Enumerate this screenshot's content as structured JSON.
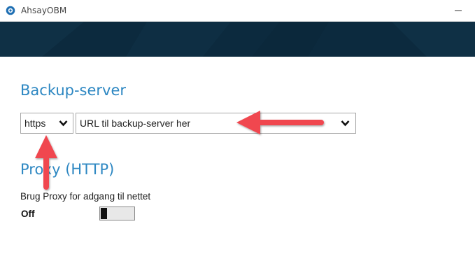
{
  "window": {
    "title": "AhsayOBM"
  },
  "backup_section": {
    "title": "Backup-server",
    "protocol": {
      "selected": "https"
    },
    "server_url": {
      "selected": "URL til backup-server her"
    }
  },
  "proxy_section": {
    "title": "Proxy (HTTP)",
    "use_proxy_label": "Brug Proxy for adgang til nettet",
    "toggle": {
      "state_label": "Off",
      "on": false
    }
  },
  "colors": {
    "banner": "#0c2a3e",
    "section_title": "#2d87c2",
    "annotation_arrow": "#f0464f"
  },
  "icons": [
    "app-logo-icon",
    "minimize-icon",
    "chevron-down-icon",
    "annotation-arrow"
  ]
}
